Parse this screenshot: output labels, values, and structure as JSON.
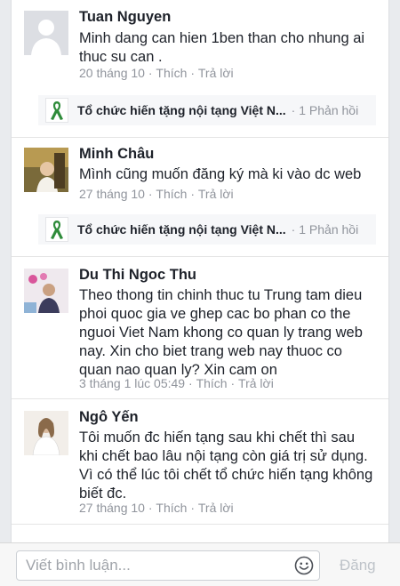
{
  "comments": [
    {
      "name": "Tuan Nguyen",
      "text": "Minh dang can hien 1ben than cho nhung ai thuc su can .",
      "time": "20 tháng 10",
      "like": "Thích",
      "reply": "Trả lời",
      "reply_summary": {
        "author": "Tổ chức hiến tặng nội tạng Việt N...",
        "count": "1 Phản hồi"
      }
    },
    {
      "name": "Minh Châu",
      "text": "Mình cũng muốn đăng ký mà ki vào dc web",
      "time": "27 tháng 10",
      "like": "Thích",
      "reply": "Trả lời",
      "reply_summary": {
        "author": "Tổ chức hiến tặng nội tạng Việt N...",
        "count": "1 Phản hồi"
      }
    },
    {
      "name": "Du Thi Ngoc Thu",
      "text": "Theo thong tin chinh thuc tu Trung tam dieu phoi quoc gia ve ghep cac bo phan co the nguoi Viet Nam khong co quan ly trang web nay. Xin cho biet trang web nay thuoc co quan nao quan ly? Xin cam on",
      "time": "3 tháng 1 lúc 05:49",
      "like": "Thích",
      "reply": "Trả lời"
    },
    {
      "name": "Ngô Yến",
      "text": "Tôi muốn đc hiến tạng sau khi chết thì sau khi chết bao lâu nội tạng còn giá trị sử dụng. Vì có thể lúc tôi chết tổ chức hiến tạng không biết đc.",
      "time": "27 tháng 10",
      "like": "Thích",
      "reply": "Trả lời"
    }
  ],
  "composer": {
    "placeholder": "Viết bình luận...",
    "send_label": "Đăng"
  },
  "colors": {
    "meta": "#90949c",
    "ribbon": "#2e8b3a",
    "send_disabled": "#bec3c9"
  }
}
